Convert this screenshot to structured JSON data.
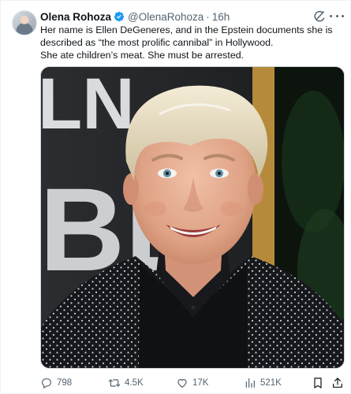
{
  "author": {
    "name": "Olena Rohoza",
    "handle": "@OlenaRohoza",
    "separator": "·",
    "time": "16h",
    "verified": true
  },
  "tweet": {
    "lines": [
      "Her name is Ellen DeGeneres, and in the Epstein documents she is",
      "described as “the most prolific cannibal” in Hollywood.",
      "She ate children’s meat. She must be arrested."
    ]
  },
  "media": {
    "backdrop_letters": [
      "LN",
      "BE"
    ]
  },
  "actions": {
    "replies": "798",
    "reposts": "4.5K",
    "likes": "17K",
    "views": "521K"
  },
  "colors": {
    "text": "#0f1419",
    "secondary": "#536471",
    "verified": "#1d9bf0",
    "border": "#cfd9de"
  },
  "icons": [
    "verified-badge-icon",
    "grok-icon",
    "more-icon",
    "reply-icon",
    "retweet-icon",
    "like-icon",
    "views-icon",
    "bookmark-icon",
    "share-icon"
  ]
}
